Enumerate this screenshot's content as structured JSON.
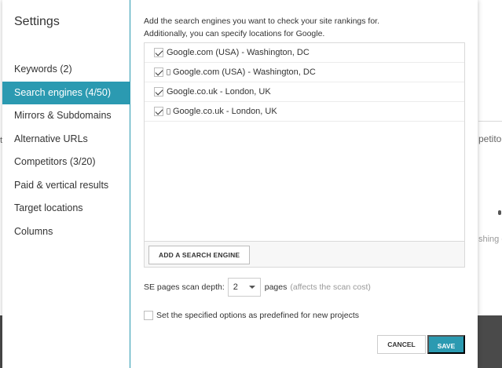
{
  "modal": {
    "title": "Settings",
    "close_icon": "close-icon"
  },
  "sidebar": {
    "items": [
      {
        "label": "Keywords (2)",
        "active": false
      },
      {
        "label": "Search engines (4/50)",
        "active": true
      },
      {
        "label": "Mirrors & Subdomains",
        "active": false
      },
      {
        "label": "Alternative URLs",
        "active": false
      },
      {
        "label": "Competitors (3/20)",
        "active": false
      },
      {
        "label": "Paid & vertical results",
        "active": false
      },
      {
        "label": "Target locations",
        "active": false
      },
      {
        "label": "Columns",
        "active": false
      }
    ]
  },
  "content": {
    "intro_line1": "Add the search engines you want to check your site rankings for.",
    "intro_line2": "Additionally, you can specify locations for Google.",
    "engines": [
      {
        "label": "Google.com (USA) - Washington, DC",
        "checked": true,
        "mobile": false
      },
      {
        "label": "Google.com (USA) - Washington, DC",
        "checked": true,
        "mobile": true
      },
      {
        "label": "Google.co.uk - London, UK",
        "checked": true,
        "mobile": false
      },
      {
        "label": "Google.co.uk - London, UK",
        "checked": true,
        "mobile": true
      }
    ],
    "add_engine_label": "ADD A SEARCH ENGINE",
    "depth_label": "SE pages scan depth:",
    "depth_value": "2",
    "depth_unit": "pages",
    "depth_note": "(affects the scan cost)",
    "predefined_label": "Set the specified options as predefined for new projects",
    "predefined_checked": false,
    "cancel_label": "CANCEL",
    "save_label": "SAVE"
  },
  "background": {
    "partial_text_1": "petito",
    "partial_text_2": "shing c",
    "partial_text_left": "t"
  },
  "colors": {
    "accent": "#2b9ab1",
    "backdrop_dark": "#4a4a4a"
  }
}
